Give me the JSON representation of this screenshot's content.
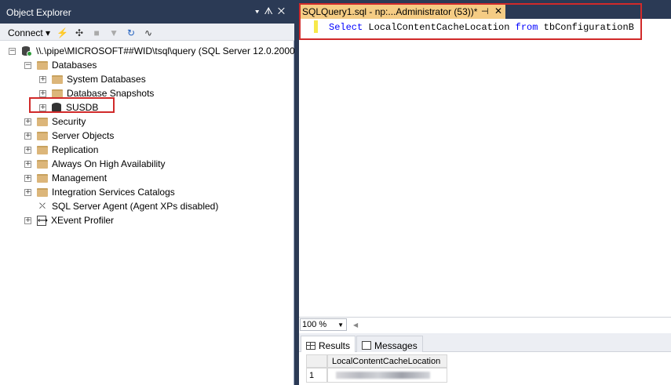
{
  "object_explorer": {
    "title": "Object Explorer",
    "title_controls": "▾ ⊢ ✕",
    "toolbar": {
      "connect_label": "Connect ▾"
    },
    "server_node": "\\\\.\\pipe\\MICROSOFT##WID\\tsql\\query (SQL Server 12.0.2000.",
    "databases_label": "Databases",
    "system_databases": "System Databases",
    "database_snapshots": "Database Snapshots",
    "susdb": "SUSDB",
    "security": "Security",
    "server_objects": "Server Objects",
    "replication": "Replication",
    "always_on": "Always On High Availability",
    "management": "Management",
    "integration_services": "Integration Services Catalogs",
    "sql_agent": "SQL Server Agent (Agent XPs disabled)",
    "xevent": "XEvent Profiler"
  },
  "query_editor": {
    "tab_title": "SQLQuery1.sql - np:...Administrator (53))*",
    "code": {
      "kw_select": "Select",
      "column": "LocalContentCacheLocation",
      "kw_from": "from",
      "table": "tbConfigurationB"
    },
    "zoom": "100 %"
  },
  "results": {
    "tabs": {
      "results": "Results",
      "messages": "Messages"
    },
    "column_header": "LocalContentCacheLocation",
    "row_number": "1"
  },
  "colors": {
    "highlight_box": "#d12a2a",
    "tab_active": "#f5cc84",
    "chrome": "#2b3a55"
  }
}
